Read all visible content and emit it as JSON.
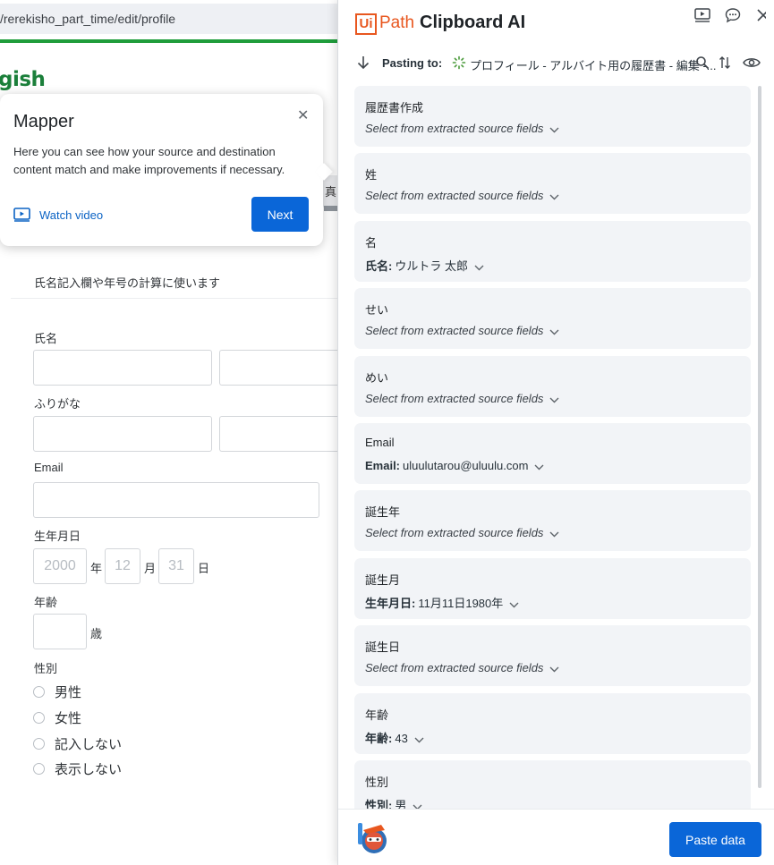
{
  "background": {
    "url": "/rerekisho_part_time/edit/profile",
    "logo_fragment": "gish",
    "covered_button": "真",
    "hint": "氏名記入欄や年号の計算に使います",
    "labels": {
      "name": "氏名",
      "furigana": "ふりがな",
      "email": "Email",
      "birthdate": "生年月日",
      "age": "年齢",
      "gender": "性別"
    },
    "birth": {
      "year_placeholder": "2000",
      "year_unit": "年",
      "month_placeholder": "12",
      "month_unit": "月",
      "day_placeholder": "31",
      "day_unit": "日"
    },
    "age_unit": "歳",
    "gender_options": [
      "男性",
      "女性",
      "記入しない",
      "表示しない"
    ]
  },
  "mapper": {
    "title": "Mapper",
    "description": "Here you can see how your source and destination content match and make improvements if necessary.",
    "watch_video": "Watch video",
    "next": "Next",
    "close_icon": "close-icon"
  },
  "panel": {
    "brand_ui": "Ui",
    "brand_path": "Path",
    "brand_name": "Clipboard AI",
    "pasting_to_label": "Pasting to:",
    "destination": "プロフィール - アルバイト用の履歴書 - 編集 -...",
    "paste_button": "Paste data",
    "header_icons": [
      "video-icon",
      "chat-icon",
      "close-icon"
    ],
    "accent_color": "#e8571f",
    "primary_color": "#0a66d8"
  },
  "mappings": [
    {
      "field": "履歴書作成",
      "placeholder": "Select from extracted source fields"
    },
    {
      "field": "姓",
      "placeholder": "Select from extracted source fields"
    },
    {
      "field": "名",
      "source_label": "氏名:",
      "source_value": "ウルトラ 太郎"
    },
    {
      "field": "せい",
      "placeholder": "Select from extracted source fields"
    },
    {
      "field": "めい",
      "placeholder": "Select from extracted source fields"
    },
    {
      "field": "Email",
      "source_label": "Email:",
      "source_value": "uluulutarou@uluulu.com"
    },
    {
      "field": "誕生年",
      "placeholder": "Select from extracted source fields"
    },
    {
      "field": "誕生月",
      "source_label": "生年月日:",
      "source_value": "11月11日1980年"
    },
    {
      "field": "誕生日",
      "placeholder": "Select from extracted source fields"
    },
    {
      "field": "年齢",
      "source_label": "年齢:",
      "source_value": "43"
    },
    {
      "field": "性別",
      "source_label": "性別:",
      "source_value": "男"
    }
  ]
}
